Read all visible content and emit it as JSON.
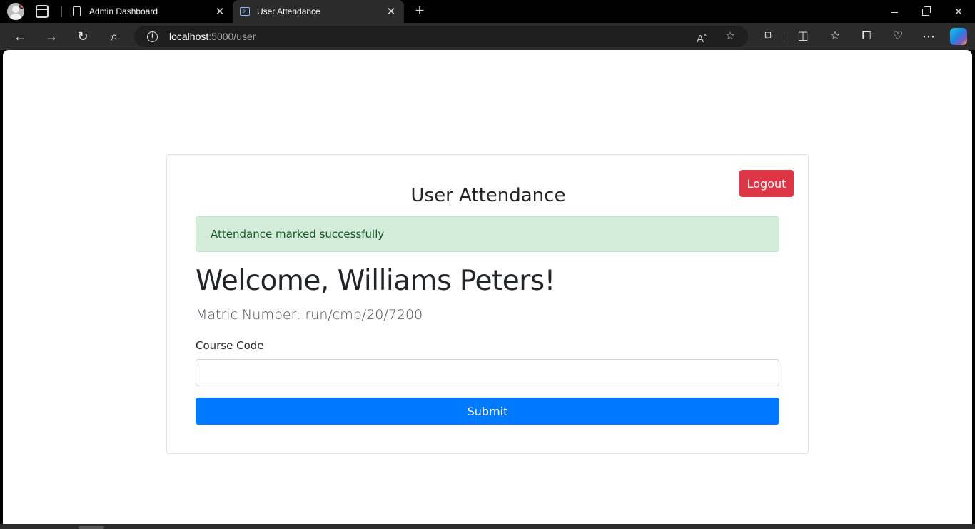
{
  "browser": {
    "tabs": [
      {
        "title": "Admin Dashboard",
        "icon": "document-icon",
        "active": false
      },
      {
        "title": "User Attendance",
        "icon": "terminal-icon",
        "active": true
      }
    ],
    "address": {
      "host": "localhost",
      "path": ":5000/user"
    },
    "icons": {
      "back": "←",
      "forward": "→",
      "reload": "↻",
      "search": "⌕",
      "new_tab": "+",
      "close": "✕",
      "more": "⋯"
    }
  },
  "page": {
    "logout_label": "Logout",
    "title": "User Attendance",
    "alert": "Attendance marked successfully",
    "welcome": "Welcome, Williams Peters!",
    "matric": "Matric Number: run/cmp/20/7200",
    "course_label": "Course Code",
    "course_value": "",
    "submit_label": "Submit"
  },
  "colors": {
    "logout": "#dc3545",
    "submit": "#007bff",
    "alert_bg": "#d4edda",
    "alert_text": "#155724"
  }
}
